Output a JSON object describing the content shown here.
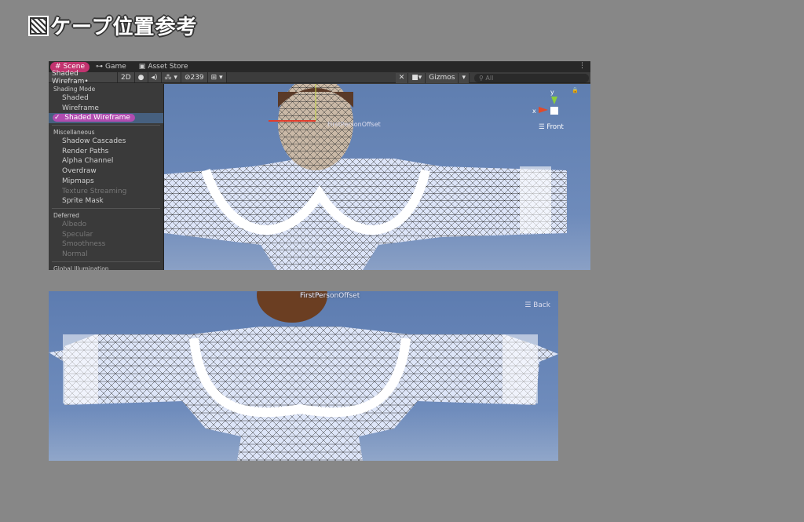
{
  "page_title": "ケープ位置参考",
  "scene_window": {
    "tabs": [
      {
        "label": "Scene",
        "icon": "hash-icon",
        "active": true
      },
      {
        "label": "Game",
        "icon": "gamepad-icon"
      },
      {
        "label": "Asset Store",
        "icon": "bag-icon"
      }
    ],
    "toolbar": {
      "draw_mode": "Shaded Wirefram•",
      "mode_2d": "2D",
      "hidden_count": "239",
      "gizmos": "Gizmos",
      "search_placeholder": "All"
    },
    "menu": {
      "sections": [
        {
          "header": "Shading Mode",
          "items": [
            {
              "label": "Shaded"
            },
            {
              "label": "Wireframe"
            },
            {
              "label": "Shaded Wireframe",
              "selected": true
            }
          ]
        },
        {
          "header": "Miscellaneous",
          "items": [
            {
              "label": "Shadow Cascades"
            },
            {
              "label": "Render Paths"
            },
            {
              "label": "Alpha Channel"
            },
            {
              "label": "Overdraw"
            },
            {
              "label": "Mipmaps"
            },
            {
              "label": "Texture Streaming",
              "disabled": true
            },
            {
              "label": "Sprite Mask"
            }
          ]
        },
        {
          "header": "Deferred",
          "items": [
            {
              "label": "Albedo",
              "disabled": true
            },
            {
              "label": "Specular",
              "disabled": true
            },
            {
              "label": "Smoothness",
              "disabled": true
            },
            {
              "label": "Normal",
              "disabled": true
            }
          ]
        },
        {
          "header": "Global Illumination",
          "items": []
        }
      ],
      "check": "✓"
    },
    "gizmo": {
      "x": "x",
      "y": "y",
      "view": "Front"
    },
    "bone_label": "FirstPersonOffset"
  },
  "back_view": {
    "bone_label": "FirstPersonOffset",
    "view": "Back"
  },
  "colors": {
    "accent": "#c2336f",
    "selected": "#b04cb0",
    "sky": "#6a88b8"
  }
}
